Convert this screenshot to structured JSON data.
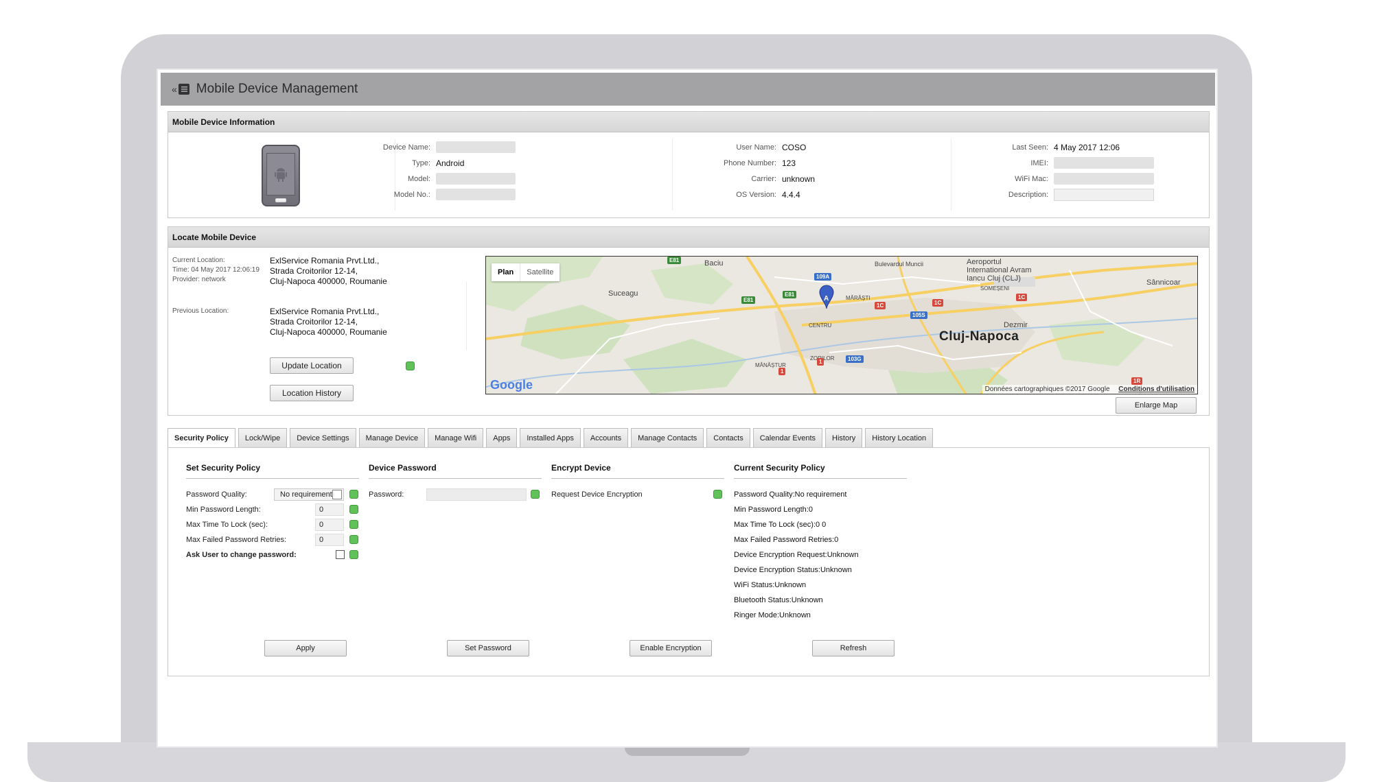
{
  "app": {
    "title": "Mobile Device Management"
  },
  "device_info": {
    "heading": "Mobile Device Information",
    "device_name_label": "Device Name:",
    "type_label": "Type:",
    "type_value": "Android",
    "model_label": "Model:",
    "model_no_label": "Model No.:",
    "user_name_label": "User Name:",
    "user_name_value": "COSO",
    "phone_number_label": "Phone Number:",
    "phone_number_value": "123",
    "carrier_label": "Carrier:",
    "carrier_value": "unknown",
    "os_version_label": "OS Version:",
    "os_version_value": "4.4.4",
    "last_seen_label": "Last Seen:",
    "last_seen_value": "4 May 2017 12:06",
    "imei_label": "IMEI:",
    "wifi_mac_label": "WiFi Mac:",
    "description_label": "Description:"
  },
  "locate": {
    "heading": "Locate Mobile Device",
    "current_location_label": "Current Location:",
    "time_label": "Time: 04 May 2017 12:06:19",
    "provider_label": "Provider: network",
    "current_address": [
      "ExlService Romania Prvt.Ltd.,",
      "Strada Croitorilor 12-14,",
      "Cluj-Napoca 400000, Roumanie"
    ],
    "previous_location_label": "Previous Location:",
    "previous_address": [
      "ExlService Romania Prvt.Ltd.,",
      "Strada Croitorilor 12-14,",
      "Cluj-Napoca 400000, Roumanie"
    ],
    "update_location_button": "Update Location",
    "location_history_button": "Location History",
    "enlarge_map_button": "Enlarge Map",
    "map": {
      "plan_label": "Plan",
      "satellite_label": "Satellite",
      "city": "Cluj-Napoca",
      "places": [
        "Baciu",
        "Suceagu",
        "Bulevardul Muncii",
        "Aeroportul International Avram Iancu Cluj (CLJ)",
        "Sânnicoar",
        "SOMEȘENI",
        "MĂRĂȘTI",
        "CENTRU",
        "ZORILOR",
        "MĂNĂȘTUR",
        "Dezmir"
      ],
      "pin_label": "A",
      "logo": "Google",
      "attribution": "Données cartographiques ©2017 Google",
      "terms": "Conditions d'utilisation",
      "road_badges": [
        "E81",
        "E81",
        "E81",
        "109A",
        "1C",
        "1C",
        "1C",
        "105S",
        "103G",
        "1",
        "1",
        "1R"
      ],
      "colors": {
        "land": "#eae8e0",
        "forest": "#cfe1bf",
        "road_major": "#f7cf62",
        "road_minor": "#ffffff",
        "urban": "#e2ded6"
      }
    }
  },
  "tabs": [
    "Security Policy",
    "Lock/Wipe",
    "Device Settings",
    "Manage Device",
    "Manage Wifi",
    "Apps",
    "Installed Apps",
    "Accounts",
    "Manage Contacts",
    "Contacts",
    "Calendar Events",
    "History",
    "History Location"
  ],
  "security_policy": {
    "set_heading": "Set Security Policy",
    "password_quality_label": "Password Quality:",
    "password_quality_value": "No requirement",
    "min_length_label": "Min Password Length:",
    "min_length_value": "0",
    "max_lock_label": "Max Time To Lock (sec):",
    "max_lock_value": "0",
    "max_failed_label": "Max Failed Password Retries:",
    "max_failed_value": "0",
    "ask_change_label": "Ask User to change password:",
    "apply_button": "Apply",
    "password_heading": "Device Password",
    "password_label": "Password:",
    "set_password_button": "Set Password",
    "encrypt_heading": "Encrypt Device",
    "request_encryption_label": "Request Device Encryption",
    "enable_encryption_button": "Enable Encryption",
    "current_heading": "Current Security Policy",
    "current_lines": [
      "Password Quality:No requirement",
      "Min Password Length:0",
      "Max Time To Lock (sec):0 0",
      "Max Failed Password Retries:0",
      "Device Encryption Request:Unknown",
      "Device Encryption Status:Unknown",
      "WiFi Status:Unknown",
      "Bluetooth Status:Unknown",
      "Ringer Mode:Unknown"
    ],
    "refresh_button": "Refresh",
    "status_color": "#62c25a"
  }
}
